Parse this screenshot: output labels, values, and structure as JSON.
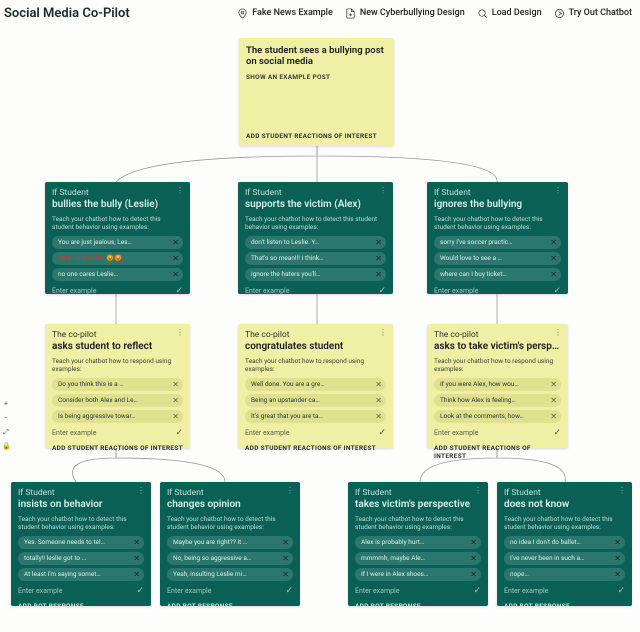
{
  "header": {
    "title": "Social Media Co-Pilot",
    "links": {
      "fake_news": "Fake News Example",
      "new_design": "New Cyberbullying Design",
      "load_design": "Load Design",
      "try_chatbot": "Try Out Chatbot"
    }
  },
  "labels": {
    "if_student": "If Student",
    "the_copilot": "The co-pilot",
    "teach_detect": "Teach your chatbot how to detect this student behavior using examples:",
    "teach_respond": "Teach your chatbot how to respond using examples:",
    "enter_example": "Enter example",
    "add_reactions": "ADD STUDENT REACTIONS OF INTEREST",
    "add_bot_response": "ADD BOT RESPONSE",
    "show_example_post": "SHOW AN EXAMPLE POST"
  },
  "root": {
    "title": "The student sees a bullying post on social media"
  },
  "row1": {
    "bullies": {
      "title": "bullies the bully (Leslie)",
      "chips": [
        "You are just jealous, Les…",
        "Shut up @Leslie 😡😡…",
        "no one cares Leslie…"
      ]
    },
    "supports": {
      "title": "supports the victim (Alex)",
      "chips": [
        "don't listen to Leslie. Y…",
        "That's so mean!!! I think…",
        "ignore the haters you'll…"
      ]
    },
    "ignores": {
      "title": "ignores the bullying",
      "chips": [
        "sorry I've soccer practic…",
        "Would love to see a …",
        "where can I buy ticket…"
      ]
    }
  },
  "row2": {
    "reflect": {
      "title": "asks student to reflect",
      "chips": [
        "Do you think this is a …",
        "Consider both Alex and Le…",
        "Is being aggressive towar…"
      ]
    },
    "congratulate": {
      "title": "congratulates student",
      "chips": [
        "Well done. You are a gre…",
        "Being an upstander ca…",
        "It's great that you are ta…"
      ]
    },
    "perspective": {
      "title": "asks to take victim's perspective",
      "chips": [
        "If you were Alex, how wou…",
        "Think how Alex is feeling…",
        "Look at the comments, how…"
      ]
    }
  },
  "row3": {
    "insists": {
      "title": "insists on behavior",
      "chips": [
        "Yes. Someone needs to tel…",
        "totally!! leslie got to …",
        "At least I'm saying somet…"
      ]
    },
    "changes": {
      "title": "changes opinion",
      "chips": [
        "Maybe you are right?? it …",
        "No, being so aggressive a…",
        "Yeah, insulting Leslie mi…"
      ]
    },
    "takes": {
      "title": "takes victim's perspective",
      "chips": [
        "Alex is probably hurt…",
        "mmmmh, maybe Ale…",
        "If I were in Alex shoes…"
      ]
    },
    "doesnotknow": {
      "title": "does not know",
      "chips": [
        "no idea I don't do ballet…",
        "I've never been in such a…",
        "nope…"
      ]
    }
  }
}
